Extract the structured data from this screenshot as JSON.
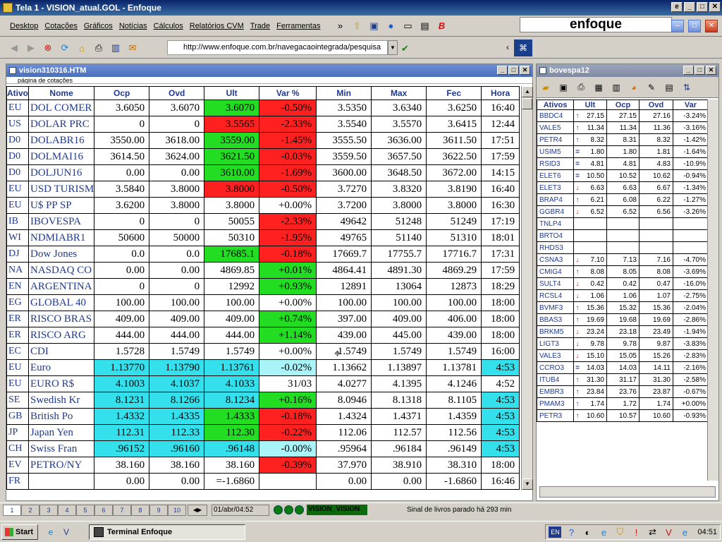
{
  "window": {
    "title": "Tela 1 - VISION_atual.GOL - Enfoque"
  },
  "menu": [
    "Desktop",
    "Cotações",
    "Gráficos",
    "Notícias",
    "Cálculos",
    "Relatórios CVM",
    "Trade",
    "Ferramentas"
  ],
  "logo": "enfoque",
  "address": {
    "url": "http://www.enfoque.com.br/navegacaointegrada/pesquisa"
  },
  "left_window": {
    "title": "vision310316.HTM",
    "tab_label": "página de cotações",
    "columns": [
      "Ativo",
      "Nome",
      "Ocp",
      "Ovd",
      "Ult",
      "Var %",
      "Min",
      "Max",
      "Fec",
      "Hora"
    ],
    "rows": [
      {
        "code": "EU",
        "name": "DOL COMER",
        "ocp": "3.6050",
        "ovd": "3.6070",
        "ult": "3.6070",
        "var": "-0.50%",
        "min": "3.5350",
        "max": "3.6340",
        "fec": "3.6250",
        "hora": "16:40",
        "ult_bg": "#22dd22",
        "var_bg": "#ff2020",
        "hora_bg": "#ffffff",
        "row_bg": "#ffffff"
      },
      {
        "code": "US",
        "name": "DOLAR PRC",
        "ocp": "0",
        "ovd": "0",
        "ult": "3.5565",
        "var": "-2.33%",
        "min": "3.5540",
        "max": "3.5570",
        "fec": "3.6415",
        "hora": "12:44",
        "ult_bg": "#ff2020",
        "var_bg": "#ff2020",
        "hora_bg": "#ffffff",
        "row_bg": "#ffffff"
      },
      {
        "code": "D0",
        "name": "DOLABR16",
        "ocp": "3550.00",
        "ovd": "3618.00",
        "ult": "3559.00",
        "var": "-1.45%",
        "min": "3555.50",
        "max": "3636.00",
        "fec": "3611.50",
        "hora": "17:51",
        "ult_bg": "#22dd22",
        "var_bg": "#ff2020",
        "hora_bg": "#ffffff",
        "row_bg": "#ffffff"
      },
      {
        "code": "D0",
        "name": "DOLMAI16",
        "ocp": "3614.50",
        "ovd": "3624.00",
        "ult": "3621.50",
        "var": "-0.03%",
        "min": "3559.50",
        "max": "3657.50",
        "fec": "3622.50",
        "hora": "17:59",
        "ult_bg": "#22dd22",
        "var_bg": "#ff2020",
        "hora_bg": "#ffffff",
        "row_bg": "#ffffff"
      },
      {
        "code": "D0",
        "name": "DOLJUN16",
        "ocp": "0.00",
        "ovd": "0.00",
        "ult": "3610.00",
        "var": "-1.69%",
        "min": "3600.00",
        "max": "3648.50",
        "fec": "3672.00",
        "hora": "14:15",
        "ult_bg": "#22dd22",
        "var_bg": "#ff2020",
        "hora_bg": "#ffffff",
        "row_bg": "#ffffff"
      },
      {
        "code": "EU",
        "name": "USD TURISM",
        "ocp": "3.5840",
        "ovd": "3.8000",
        "ult": "3.8000",
        "var": "-0.50%",
        "min": "3.7270",
        "max": "3.8320",
        "fec": "3.8190",
        "hora": "16:40",
        "ult_bg": "#ff2020",
        "var_bg": "#ff2020",
        "hora_bg": "#ffffff",
        "row_bg": "#ffffff"
      },
      {
        "code": "EU",
        "name": "U$ PP SP",
        "ocp": "3.6200",
        "ovd": "3.8000",
        "ult": "3.8000",
        "var": "+0.00%",
        "min": "3.7200",
        "max": "3.8000",
        "fec": "3.8000",
        "hora": "16:30",
        "ult_bg": "#ffffff",
        "var_bg": "#ffffff",
        "hora_bg": "#ffffff",
        "row_bg": "#ffffff"
      },
      {
        "code": "IB",
        "name": "IBOVESPA",
        "ocp": "0",
        "ovd": "0",
        "ult": "50055",
        "var": "-2.33%",
        "min": "49642",
        "max": "51248",
        "fec": "51249",
        "hora": "17:19",
        "ult_bg": "#ffffff",
        "var_bg": "#ff2020",
        "hora_bg": "#ffffff",
        "row_bg": "#ffffff"
      },
      {
        "code": "WI",
        "name": "NDMIABR1",
        "ocp": "50600",
        "ovd": "50000",
        "ult": "50310",
        "var": "-1.95%",
        "min": "49765",
        "max": "51140",
        "fec": "51310",
        "hora": "18:01",
        "ult_bg": "#ffffff",
        "var_bg": "#ff2020",
        "hora_bg": "#ffffff",
        "row_bg": "#ffffff"
      },
      {
        "code": "DJ",
        "name": "Dow Jones",
        "ocp": "0.0",
        "ovd": "0.0",
        "ult": "17685.1",
        "var": "-0.18%",
        "min": "17669.7",
        "max": "17755.7",
        "fec": "17716.7",
        "hora": "17:31",
        "ult_bg": "#22dd22",
        "var_bg": "#ff2020",
        "hora_bg": "#ffffff",
        "row_bg": "#ffffff"
      },
      {
        "code": "NA",
        "name": "NASDAQ CO",
        "ocp": "0.00",
        "ovd": "0.00",
        "ult": "4869.85",
        "var": "+0.01%",
        "min": "4864.41",
        "max": "4891.30",
        "fec": "4869.29",
        "hora": "17:59",
        "ult_bg": "#ffffff",
        "var_bg": "#22dd22",
        "hora_bg": "#ffffff",
        "row_bg": "#ffffff"
      },
      {
        "code": "EN",
        "name": "ARGENTINA",
        "ocp": "0",
        "ovd": "0",
        "ult": "12992",
        "var": "+0.93%",
        "min": "12891",
        "max": "13064",
        "fec": "12873",
        "hora": "18:29",
        "ult_bg": "#ffffff",
        "var_bg": "#22dd22",
        "hora_bg": "#ffffff",
        "row_bg": "#ffffff"
      },
      {
        "code": "EG",
        "name": "GLOBAL 40",
        "ocp": "100.00",
        "ovd": "100.00",
        "ult": "100.00",
        "var": "+0.00%",
        "min": "100.00",
        "max": "100.00",
        "fec": "100.00",
        "hora": "18:00",
        "ult_bg": "#ffffff",
        "var_bg": "#ffffff",
        "hora_bg": "#ffffff",
        "row_bg": "#ffffff"
      },
      {
        "code": "ER",
        "name": "RISCO BRAS",
        "ocp": "409.00",
        "ovd": "409.00",
        "ult": "409.00",
        "var": "+0.74%",
        "min": "397.00",
        "max": "409.00",
        "fec": "406.00",
        "hora": "18:00",
        "ult_bg": "#ffffff",
        "var_bg": "#22dd22",
        "hora_bg": "#ffffff",
        "row_bg": "#ffffff"
      },
      {
        "code": "ER",
        "name": "RISCO ARG",
        "ocp": "444.00",
        "ovd": "444.00",
        "ult": "444.00",
        "var": "+1.14%",
        "min": "439.00",
        "max": "445.00",
        "fec": "439.00",
        "hora": "18:00",
        "ult_bg": "#ffffff",
        "var_bg": "#22dd22",
        "hora_bg": "#ffffff",
        "row_bg": "#ffffff"
      },
      {
        "code": "EC",
        "name": "CDI",
        "ocp": "1.5728",
        "ovd": "1.5749",
        "ult": "1.5749",
        "var": "+0.00%",
        "min": "1.5749",
        "max": "1.5749",
        "fec": "1.5749",
        "hora": "16:00",
        "ult_bg": "#ffffff",
        "var_bg": "#ffffff",
        "hora_bg": "#ffffff",
        "row_bg": "#ffffff"
      },
      {
        "code": "EU",
        "name": "Euro",
        "ocp": "1.13770",
        "ovd": "1.13790",
        "ult": "1.13761",
        "var": "-0.02%",
        "min": "1.13662",
        "max": "1.13897",
        "fec": "1.13781",
        "hora": "4:53",
        "ult_bg": "#33e0ec",
        "var_bg": "#a8f4f8",
        "hora_bg": "#33e0ec",
        "row_bg": "#33e0ec"
      },
      {
        "code": "EU",
        "name": "EURO R$",
        "ocp": "4.1003",
        "ovd": "4.1037",
        "ult": "4.1033",
        "var": "31/03",
        "min": "4.0277",
        "max": "4.1395",
        "fec": "4.1246",
        "hora": "4:52",
        "ult_bg": "#33e0ec",
        "var_bg": "#ffffff",
        "hora_bg": "#ffffff",
        "row_bg": "#33e0ec"
      },
      {
        "code": "SE",
        "name": "Swedish Kr",
        "ocp": "8.1231",
        "ovd": "8.1266",
        "ult": "8.1234",
        "var": "+0.16%",
        "min": "8.0946",
        "max": "8.1318",
        "fec": "8.1105",
        "hora": "4:53",
        "ult_bg": "#33e0ec",
        "var_bg": "#22dd22",
        "hora_bg": "#33e0ec",
        "row_bg": "#33e0ec"
      },
      {
        "code": "GB",
        "name": "British Po",
        "ocp": "1.4332",
        "ovd": "1.4335",
        "ult": "1.4333",
        "var": "-0.18%",
        "min": "1.4324",
        "max": "1.4371",
        "fec": "1.4359",
        "hora": "4:53",
        "ult_bg": "#22dd22",
        "var_bg": "#ff2020",
        "hora_bg": "#33e0ec",
        "row_bg": "#33e0ec"
      },
      {
        "code": "JP",
        "name": "Japan Yen",
        "ocp": "112.31",
        "ovd": "112.33",
        "ult": "112.30",
        "var": "-0.22%",
        "min": "112.06",
        "max": "112.57",
        "fec": "112.56",
        "hora": "4:53",
        "ult_bg": "#22dd22",
        "var_bg": "#ff2020",
        "hora_bg": "#33e0ec",
        "row_bg": "#33e0ec"
      },
      {
        "code": "CH",
        "name": "Swiss Fran",
        "ocp": ".96152",
        "ovd": ".96160",
        "ult": ".96148",
        "var": "-0.00%",
        "min": ".95964",
        "max": ".96184",
        "fec": ".96149",
        "hora": "4:53",
        "ult_bg": "#33e0ec",
        "var_bg": "#a8f4f8",
        "hora_bg": "#33e0ec",
        "row_bg": "#33e0ec"
      },
      {
        "code": "EV",
        "name": "PETRO/NY",
        "ocp": "38.160",
        "ovd": "38.160",
        "ult": "38.160",
        "var": "-0.39%",
        "min": "37.970",
        "max": "38.910",
        "fec": "38.310",
        "hora": "18:00",
        "ult_bg": "#ffffff",
        "var_bg": "#ff2020",
        "hora_bg": "#ffffff",
        "row_bg": "#ffffff"
      },
      {
        "code": "FR",
        "name": "",
        "ocp": "0.00",
        "ovd": "0.00",
        "ult": "=-1.6860",
        "var": "",
        "min": "0.00",
        "max": "0.00",
        "fec": "-1.6860",
        "hora": "16:46",
        "ult_bg": "#ffffff",
        "var_bg": "#ffffff",
        "hora_bg": "#ffffff",
        "row_bg": "#ffffff"
      }
    ]
  },
  "right_window": {
    "title": "bovespa12",
    "columns": [
      "Ativos",
      "Ult",
      "Ocp",
      "Ovd",
      "Var"
    ],
    "rows": [
      {
        "ativo": "BBDC4",
        "dir": "up",
        "ult": "27.15",
        "ocp": "27.15",
        "ovd": "27.16",
        "var": "-3.24%"
      },
      {
        "ativo": "VALE5",
        "dir": "up",
        "ult": "11.34",
        "ocp": "11.34",
        "ovd": "11.36",
        "var": "-3.16%"
      },
      {
        "ativo": "PETR4",
        "dir": "up",
        "ult": "8.32",
        "ocp": "8.31",
        "ovd": "8.32",
        "var": "-1.42%"
      },
      {
        "ativo": "USIM5",
        "dir": "eq",
        "ult": "1.80",
        "ocp": "1.80",
        "ovd": "1.81",
        "var": "-1.64%"
      },
      {
        "ativo": "RSID3",
        "dir": "eq",
        "ult": "4.81",
        "ocp": "4.81",
        "ovd": "4.83",
        "var": "-10.9%"
      },
      {
        "ativo": "ELET6",
        "dir": "eq",
        "ult": "10.50",
        "ocp": "10.52",
        "ovd": "10.62",
        "var": "-0.94%"
      },
      {
        "ativo": "ELET3",
        "dir": "dn",
        "ult": "6.63",
        "ocp": "6.63",
        "ovd": "6.67",
        "var": "-1.34%"
      },
      {
        "ativo": "BRAP4",
        "dir": "up",
        "ult": "6.21",
        "ocp": "6.08",
        "ovd": "6.22",
        "var": "-1.27%"
      },
      {
        "ativo": "GGBR4",
        "dir": "dn",
        "ult": "6.52",
        "ocp": "6.52",
        "ovd": "6.56",
        "var": "-3.26%"
      },
      {
        "ativo": "TNLP4",
        "dir": "",
        "ult": "",
        "ocp": "",
        "ovd": "",
        "var": ""
      },
      {
        "ativo": "BRTO4",
        "dir": "",
        "ult": "",
        "ocp": "",
        "ovd": "",
        "var": ""
      },
      {
        "ativo": "RHDS3",
        "dir": "",
        "ult": "",
        "ocp": "",
        "ovd": "",
        "var": ""
      },
      {
        "ativo": "CSNA3",
        "dir": "dn",
        "ult": "7.10",
        "ocp": "7.13",
        "ovd": "7.16",
        "var": "-4.70%"
      },
      {
        "ativo": "CMIG4",
        "dir": "up",
        "ult": "8.08",
        "ocp": "8.05",
        "ovd": "8.08",
        "var": "-3.69%"
      },
      {
        "ativo": "SULT4",
        "dir": "dn",
        "ult": "0.42",
        "ocp": "0.42",
        "ovd": "0.47",
        "var": "-16.0%"
      },
      {
        "ativo": "RCSL4",
        "dir": "dn",
        "ult": "1.06",
        "ocp": "1.06",
        "ovd": "1.07",
        "var": "-2.75%"
      },
      {
        "ativo": "BVMF3",
        "dir": "up",
        "ult": "15.36",
        "ocp": "15.32",
        "ovd": "15.36",
        "var": "-2.04%"
      },
      {
        "ativo": "BBAS3",
        "dir": "up",
        "ult": "19.69",
        "ocp": "19.68",
        "ovd": "19.69",
        "var": "-2.86%"
      },
      {
        "ativo": "BRKM5",
        "dir": "dn",
        "ult": "23.24",
        "ocp": "23.18",
        "ovd": "23.49",
        "var": "-1.94%"
      },
      {
        "ativo": "LIGT3",
        "dir": "dn",
        "ult": "9.78",
        "ocp": "9.78",
        "ovd": "9.87",
        "var": "-3.83%"
      },
      {
        "ativo": "VALE3",
        "dir": "dn",
        "ult": "15.10",
        "ocp": "15.05",
        "ovd": "15.26",
        "var": "-2.83%"
      },
      {
        "ativo": "CCRO3",
        "dir": "eq",
        "ult": "14.03",
        "ocp": "14.03",
        "ovd": "14.11",
        "var": "-2.16%"
      },
      {
        "ativo": "ITUB4",
        "dir": "up",
        "ult": "31.30",
        "ocp": "31.17",
        "ovd": "31.30",
        "var": "-2.58%"
      },
      {
        "ativo": "EMBR3",
        "dir": "up",
        "ult": "23.84",
        "ocp": "23.76",
        "ovd": "23.87",
        "var": "-0.67%"
      },
      {
        "ativo": "PMAM3",
        "dir": "up",
        "ult": "1.74",
        "ocp": "1.72",
        "ovd": "1.74",
        "var": "+0.00%"
      },
      {
        "ativo": "PETR3",
        "dir": "up",
        "ult": "10.60",
        "ocp": "10.57",
        "ovd": "10.60",
        "var": "-0.93%"
      }
    ]
  },
  "status": {
    "sheet_tabs": [
      "1",
      "2",
      "3",
      "4",
      "5",
      "6",
      "7",
      "8",
      "9",
      "10"
    ],
    "active_tab": "1",
    "datetime": "01/abr/04:52",
    "vision_label": "VISION_VISION",
    "message": "Sinal de livros parado há 293 min"
  },
  "taskbar": {
    "start_label": "Start",
    "task_label": "Terminal Enfoque",
    "lang": "EN",
    "clock": "04:51"
  },
  "colors": {
    "green": "#22dd22",
    "red": "#ff2020",
    "cyan": "#33e0ec",
    "light_cyan": "#a8f4f8",
    "header_blue": "#1f3a8f"
  }
}
